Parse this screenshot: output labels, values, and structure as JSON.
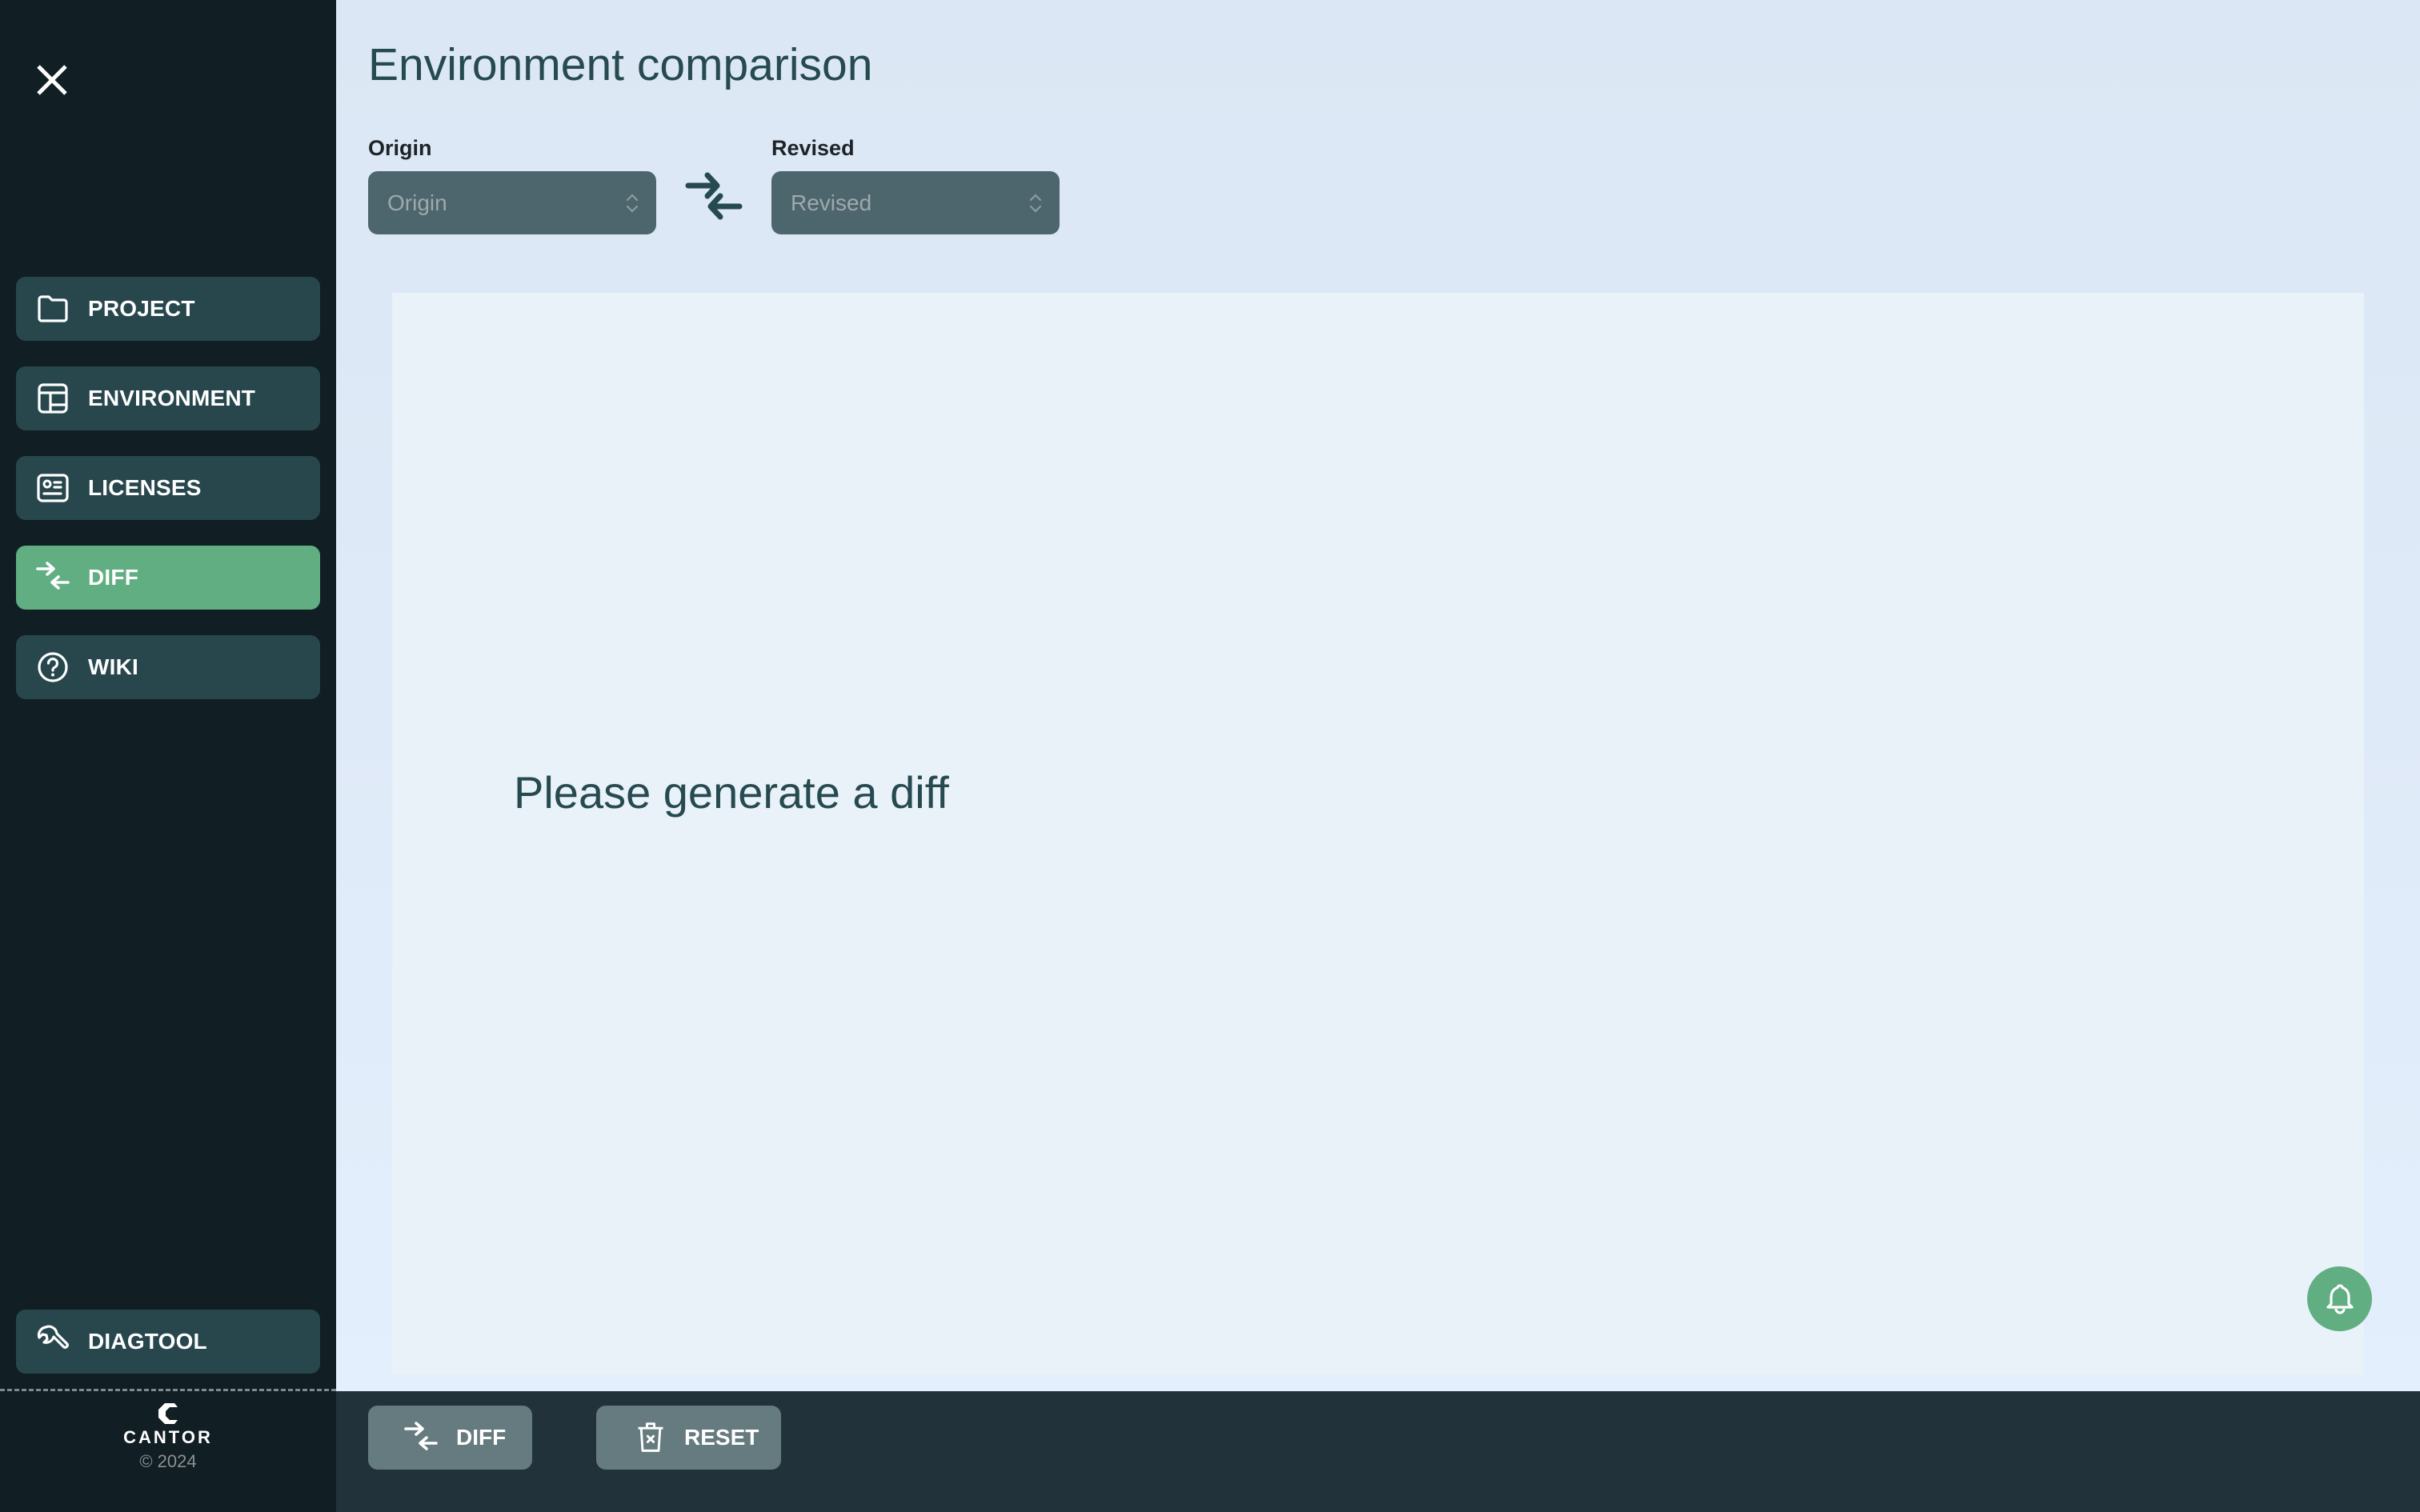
{
  "sidebar": {
    "close_icon": "close-icon",
    "nav": [
      {
        "label": "PROJECT",
        "icon": "folder-icon",
        "active": false
      },
      {
        "label": "ENVIRONMENT",
        "icon": "layout-icon",
        "active": false
      },
      {
        "label": "LICENSES",
        "icon": "id-card-icon",
        "active": false
      },
      {
        "label": "DIFF",
        "icon": "swap-arrows-icon",
        "active": true
      },
      {
        "label": "WIKI",
        "icon": "help-circle-icon",
        "active": false
      }
    ],
    "diagtool": {
      "label": "DIAGTOOL",
      "icon": "wrench-icon"
    },
    "brand": {
      "name": "CANTOR",
      "copyright": "© 2024"
    }
  },
  "main": {
    "title": "Environment comparison",
    "origin": {
      "label": "Origin",
      "placeholder": "Origin"
    },
    "revised": {
      "label": "Revised",
      "placeholder": "Revised"
    },
    "swap_icon": "swap-arrows-icon",
    "empty_message": "Please generate a diff",
    "notifications_icon": "bell-icon"
  },
  "actions": {
    "diff": {
      "label": "DIFF",
      "icon": "swap-arrows-icon"
    },
    "reset": {
      "label": "RESET",
      "icon": "trash-icon"
    }
  },
  "colors": {
    "sidebar_bg": "#111e23",
    "nav_item_bg": "#27474d",
    "accent_green": "#61ae82",
    "title_text": "#264a50",
    "select_bg": "#4d666d",
    "bottom_bar_bg": "#22323a",
    "action_button_bg": "#667b7f"
  }
}
